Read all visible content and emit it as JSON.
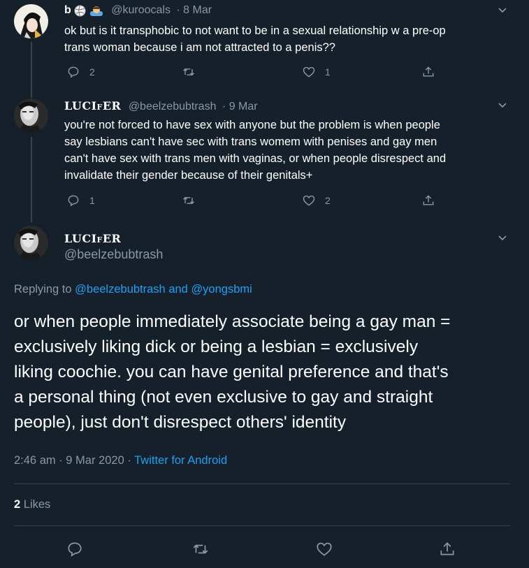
{
  "colors": {
    "background": "#15202b",
    "text": "#ffffff",
    "muted": "#8899a6",
    "accent": "#1da1f2",
    "divider": "#38444d"
  },
  "tweet1": {
    "name_emoji_text": "ƅ🏐🙇",
    "handle": "@kuroocals",
    "date": "· 8 Mar",
    "text_line1": "ok but is it transphobic to not want to be in a sexual relationship w a pre-op",
    "text_line2": "trans woman because i am not attracted to a penis??",
    "reply_count": "2",
    "retweet_count": "",
    "like_count": "1",
    "icons": [
      "reply-icon",
      "retweet-icon",
      "like-icon",
      "share-icon",
      "chevron-down-icon"
    ]
  },
  "tweet2": {
    "name": "ʟᴜᴄĹꜰᴇʀ",
    "display_name": "LUCIfER",
    "handle": "@beelzebubtrash",
    "date": "· 9 Mar",
    "text_line1": "you're not forced to have sex with anyone but the problem is when people",
    "text_line2": "say lesbians can't have sec with trans womem with penises and gay men",
    "text_line3": "can't have sex with trans men with vaginas, or when people disrespect and",
    "text_line4": "invalidate their gender because of their genitals+",
    "reply_count": "1",
    "retweet_count": "",
    "like_count": "2"
  },
  "main_tweet": {
    "display_name": "LUCIfER",
    "handle": "@beelzebubtrash",
    "replying_prefix": "Replying to ",
    "replying_user1": "@beelzebubtrash",
    "replying_and": " and ",
    "replying_user2": "@yongsbmi",
    "text_line1": "or when people immediately associate being a gay man =",
    "text_line2": "exclusively liking dick or being a lesbian = exclusively",
    "text_line3": "liking coochie. you can have genital preference and that's",
    "text_line4": "a personal thing (not even exclusive to gay and straight",
    "text_line5": "people), just don't disrespect others' identity",
    "time": "2:46 am",
    "date": "· 9 Mar 2020 ·",
    "source": "Twitter for Android",
    "likes_count": "2",
    "likes_label": "Likes"
  }
}
